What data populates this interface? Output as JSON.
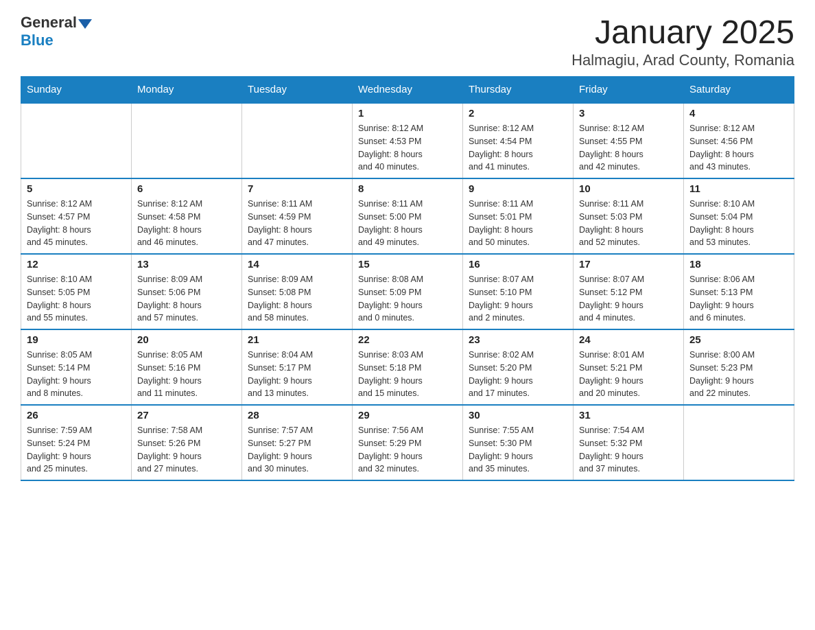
{
  "logo": {
    "general": "General",
    "blue": "Blue"
  },
  "title": "January 2025",
  "subtitle": "Halmagiu, Arad County, Romania",
  "days_header": [
    "Sunday",
    "Monday",
    "Tuesday",
    "Wednesday",
    "Thursday",
    "Friday",
    "Saturday"
  ],
  "weeks": [
    [
      {
        "day": "",
        "info": ""
      },
      {
        "day": "",
        "info": ""
      },
      {
        "day": "",
        "info": ""
      },
      {
        "day": "1",
        "info": "Sunrise: 8:12 AM\nSunset: 4:53 PM\nDaylight: 8 hours\nand 40 minutes."
      },
      {
        "day": "2",
        "info": "Sunrise: 8:12 AM\nSunset: 4:54 PM\nDaylight: 8 hours\nand 41 minutes."
      },
      {
        "day": "3",
        "info": "Sunrise: 8:12 AM\nSunset: 4:55 PM\nDaylight: 8 hours\nand 42 minutes."
      },
      {
        "day": "4",
        "info": "Sunrise: 8:12 AM\nSunset: 4:56 PM\nDaylight: 8 hours\nand 43 minutes."
      }
    ],
    [
      {
        "day": "5",
        "info": "Sunrise: 8:12 AM\nSunset: 4:57 PM\nDaylight: 8 hours\nand 45 minutes."
      },
      {
        "day": "6",
        "info": "Sunrise: 8:12 AM\nSunset: 4:58 PM\nDaylight: 8 hours\nand 46 minutes."
      },
      {
        "day": "7",
        "info": "Sunrise: 8:11 AM\nSunset: 4:59 PM\nDaylight: 8 hours\nand 47 minutes."
      },
      {
        "day": "8",
        "info": "Sunrise: 8:11 AM\nSunset: 5:00 PM\nDaylight: 8 hours\nand 49 minutes."
      },
      {
        "day": "9",
        "info": "Sunrise: 8:11 AM\nSunset: 5:01 PM\nDaylight: 8 hours\nand 50 minutes."
      },
      {
        "day": "10",
        "info": "Sunrise: 8:11 AM\nSunset: 5:03 PM\nDaylight: 8 hours\nand 52 minutes."
      },
      {
        "day": "11",
        "info": "Sunrise: 8:10 AM\nSunset: 5:04 PM\nDaylight: 8 hours\nand 53 minutes."
      }
    ],
    [
      {
        "day": "12",
        "info": "Sunrise: 8:10 AM\nSunset: 5:05 PM\nDaylight: 8 hours\nand 55 minutes."
      },
      {
        "day": "13",
        "info": "Sunrise: 8:09 AM\nSunset: 5:06 PM\nDaylight: 8 hours\nand 57 minutes."
      },
      {
        "day": "14",
        "info": "Sunrise: 8:09 AM\nSunset: 5:08 PM\nDaylight: 8 hours\nand 58 minutes."
      },
      {
        "day": "15",
        "info": "Sunrise: 8:08 AM\nSunset: 5:09 PM\nDaylight: 9 hours\nand 0 minutes."
      },
      {
        "day": "16",
        "info": "Sunrise: 8:07 AM\nSunset: 5:10 PM\nDaylight: 9 hours\nand 2 minutes."
      },
      {
        "day": "17",
        "info": "Sunrise: 8:07 AM\nSunset: 5:12 PM\nDaylight: 9 hours\nand 4 minutes."
      },
      {
        "day": "18",
        "info": "Sunrise: 8:06 AM\nSunset: 5:13 PM\nDaylight: 9 hours\nand 6 minutes."
      }
    ],
    [
      {
        "day": "19",
        "info": "Sunrise: 8:05 AM\nSunset: 5:14 PM\nDaylight: 9 hours\nand 8 minutes."
      },
      {
        "day": "20",
        "info": "Sunrise: 8:05 AM\nSunset: 5:16 PM\nDaylight: 9 hours\nand 11 minutes."
      },
      {
        "day": "21",
        "info": "Sunrise: 8:04 AM\nSunset: 5:17 PM\nDaylight: 9 hours\nand 13 minutes."
      },
      {
        "day": "22",
        "info": "Sunrise: 8:03 AM\nSunset: 5:18 PM\nDaylight: 9 hours\nand 15 minutes."
      },
      {
        "day": "23",
        "info": "Sunrise: 8:02 AM\nSunset: 5:20 PM\nDaylight: 9 hours\nand 17 minutes."
      },
      {
        "day": "24",
        "info": "Sunrise: 8:01 AM\nSunset: 5:21 PM\nDaylight: 9 hours\nand 20 minutes."
      },
      {
        "day": "25",
        "info": "Sunrise: 8:00 AM\nSunset: 5:23 PM\nDaylight: 9 hours\nand 22 minutes."
      }
    ],
    [
      {
        "day": "26",
        "info": "Sunrise: 7:59 AM\nSunset: 5:24 PM\nDaylight: 9 hours\nand 25 minutes."
      },
      {
        "day": "27",
        "info": "Sunrise: 7:58 AM\nSunset: 5:26 PM\nDaylight: 9 hours\nand 27 minutes."
      },
      {
        "day": "28",
        "info": "Sunrise: 7:57 AM\nSunset: 5:27 PM\nDaylight: 9 hours\nand 30 minutes."
      },
      {
        "day": "29",
        "info": "Sunrise: 7:56 AM\nSunset: 5:29 PM\nDaylight: 9 hours\nand 32 minutes."
      },
      {
        "day": "30",
        "info": "Sunrise: 7:55 AM\nSunset: 5:30 PM\nDaylight: 9 hours\nand 35 minutes."
      },
      {
        "day": "31",
        "info": "Sunrise: 7:54 AM\nSunset: 5:32 PM\nDaylight: 9 hours\nand 37 minutes."
      },
      {
        "day": "",
        "info": ""
      }
    ]
  ]
}
